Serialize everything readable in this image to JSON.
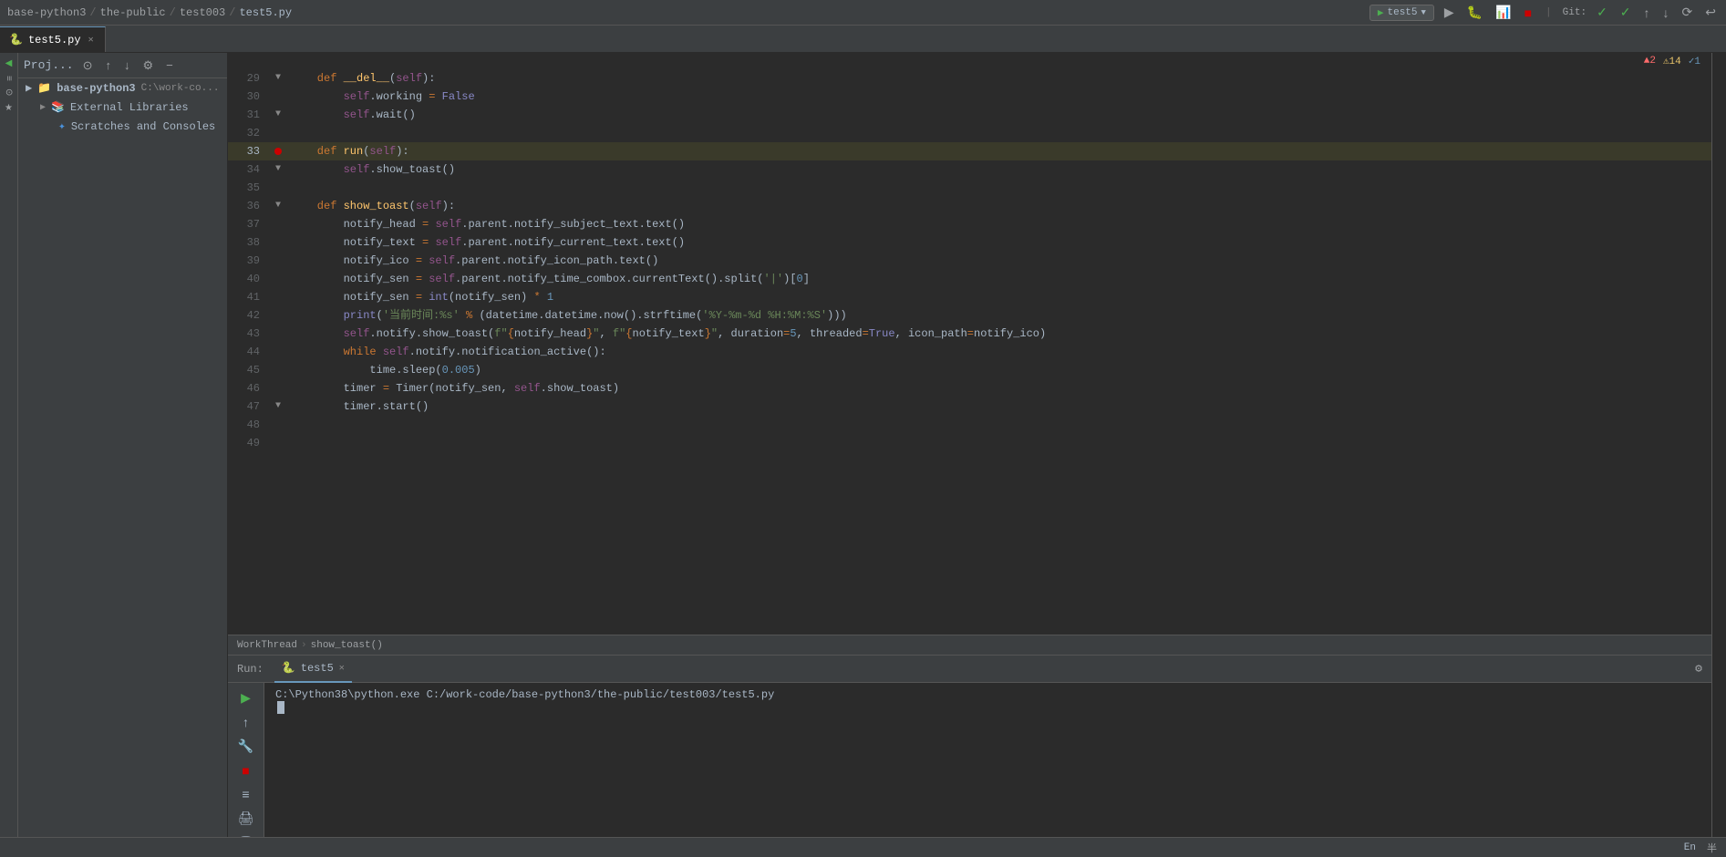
{
  "topbar": {
    "breadcrumb": [
      "base-python3",
      "the-public",
      "test003"
    ],
    "active_file": "test5.py",
    "run_config": "test5",
    "git_label": "Git:",
    "warnings": {
      "errors": "▲2",
      "warnings": "⚠14",
      "info": "✓1"
    }
  },
  "tabs": [
    {
      "name": "test5.py",
      "active": true,
      "icon": "🐍"
    }
  ],
  "sidebar": {
    "proj_name": "Proj...",
    "items": [
      {
        "label": "base-python3",
        "path": "C:\\work-code",
        "type": "folder",
        "expanded": true
      },
      {
        "label": "External Libraries",
        "type": "folder",
        "expanded": false
      },
      {
        "label": "Scratches and Consoles",
        "type": "scratches"
      }
    ]
  },
  "code": {
    "lines": [
      {
        "num": 29,
        "content": "    def __del__(self):",
        "gutter": "fold"
      },
      {
        "num": 30,
        "content": "        self.working = False",
        "gutter": ""
      },
      {
        "num": 31,
        "content": "        self.wait()",
        "gutter": "fold"
      },
      {
        "num": 32,
        "content": "",
        "gutter": ""
      },
      {
        "num": 33,
        "content": "    def run(self):",
        "gutter": "breakpoint",
        "highlight": true
      },
      {
        "num": 34,
        "content": "        self.show_toast()",
        "gutter": "fold"
      },
      {
        "num": 35,
        "content": "",
        "gutter": ""
      },
      {
        "num": 36,
        "content": "    def show_toast(self):",
        "gutter": "fold"
      },
      {
        "num": 37,
        "content": "        notify_head = self.parent.notify_subject_text.text()",
        "gutter": ""
      },
      {
        "num": 38,
        "content": "        notify_text = self.parent.notify_current_text.text()",
        "gutter": ""
      },
      {
        "num": 39,
        "content": "        notify_ico = self.parent.notify_icon_path.text()",
        "gutter": ""
      },
      {
        "num": 40,
        "content": "        notify_sen = self.parent.notify_time_combox.currentText().split('|')[0]",
        "gutter": ""
      },
      {
        "num": 41,
        "content": "        notify_sen = int(notify_sen) * 1",
        "gutter": ""
      },
      {
        "num": 42,
        "content": "        print('当前时间:%s' % (datetime.datetime.now().strftime('%Y-%m-%d %H:%M:%S')))",
        "gutter": ""
      },
      {
        "num": 43,
        "content": "        self.notify.show_toast(f\"{notify_head}\", f\"{notify_text}\", duration=5, threaded=True, icon_path=notify_ico)",
        "gutter": ""
      },
      {
        "num": 44,
        "content": "        while self.notify.notification_active():",
        "gutter": ""
      },
      {
        "num": 45,
        "content": "            time.sleep(0.005)",
        "gutter": ""
      },
      {
        "num": 46,
        "content": "        timer = Timer(notify_sen, self.show_toast)",
        "gutter": ""
      },
      {
        "num": 47,
        "content": "        timer.start()",
        "gutter": "fold"
      },
      {
        "num": 48,
        "content": "",
        "gutter": ""
      },
      {
        "num": 49,
        "content": "",
        "gutter": ""
      }
    ]
  },
  "status_breadcrumb": {
    "class_name": "WorkThread",
    "method_name": "show_toast()"
  },
  "run_panel": {
    "label": "Run:",
    "tab_name": "test5",
    "command": "C:\\Python38\\python.exe C:/work-code/base-python3/the-public/test003/test5.py"
  },
  "bottom_status": {
    "lang": "En",
    "encoding": "半"
  }
}
